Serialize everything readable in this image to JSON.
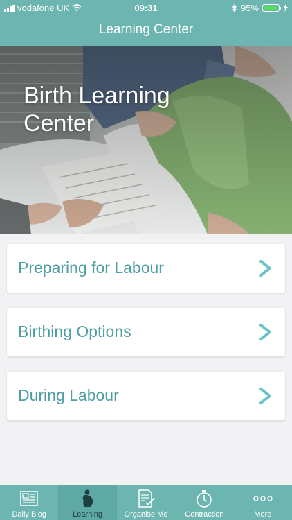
{
  "status_bar": {
    "carrier": "vodafone UK",
    "time": "09:31",
    "battery": "95%",
    "battery_level": 0.95
  },
  "header": {
    "title": "Learning Center"
  },
  "hero": {
    "title": "Birth Learning Center"
  },
  "menu": {
    "items": [
      {
        "label": "Preparing for Labour",
        "icon": "chevron-right-icon"
      },
      {
        "label": "Birthing Options",
        "icon": "chevron-right-icon"
      },
      {
        "label": "During Labour",
        "icon": "chevron-right-icon"
      }
    ]
  },
  "tabbar": {
    "items": [
      {
        "label": "Daily Blog",
        "icon": "blog-icon",
        "active": false
      },
      {
        "label": "Learning",
        "icon": "pregnancy-icon",
        "active": true
      },
      {
        "label": "Organise Me",
        "icon": "checklist-icon",
        "active": false
      },
      {
        "label": "Contraction",
        "icon": "stopwatch-icon",
        "active": false
      },
      {
        "label": "More",
        "icon": "more-icon",
        "active": false
      }
    ]
  },
  "colors": {
    "header": "#6cb5b0",
    "accent_text": "#4e9fa4",
    "chevron": "#6cc3c7",
    "active_tab_bg": "#5fa9a4"
  }
}
